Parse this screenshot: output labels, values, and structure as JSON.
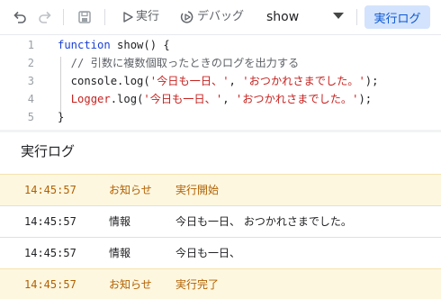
{
  "toolbar": {
    "undo_icon": "undo-icon",
    "redo_icon": "redo-icon",
    "save_icon": "save-icon",
    "run_label": "実行",
    "debug_label": "デバッグ",
    "function_select": "show",
    "log_button_label": "実行ログ"
  },
  "editor": {
    "lines": [
      {
        "number": "1",
        "tokens": [
          {
            "t": "function",
            "c": "kw"
          },
          {
            "t": " show() {",
            "c": "plain"
          }
        ]
      },
      {
        "number": "2",
        "tokens": [
          {
            "t": "  // 引数に複数個取ったときのログを出力する",
            "c": "cm"
          }
        ]
      },
      {
        "number": "3",
        "tokens": [
          {
            "t": "  console.log(",
            "c": "plain"
          },
          {
            "t": "'今日も一日、'",
            "c": "str"
          },
          {
            "t": ", ",
            "c": "plain"
          },
          {
            "t": "'おつかれさまでした。'",
            "c": "str"
          },
          {
            "t": ");",
            "c": "plain"
          }
        ]
      },
      {
        "number": "4",
        "tokens": [
          {
            "t": "  ",
            "c": "plain"
          },
          {
            "t": "Logger",
            "c": "obj"
          },
          {
            "t": ".log(",
            "c": "plain"
          },
          {
            "t": "'今日も一日、'",
            "c": "str"
          },
          {
            "t": ", ",
            "c": "plain"
          },
          {
            "t": "'おつかれさまでした。'",
            "c": "str"
          },
          {
            "t": ");",
            "c": "plain"
          }
        ]
      },
      {
        "number": "5",
        "tokens": [
          {
            "t": "}",
            "c": "plain"
          }
        ]
      }
    ]
  },
  "log_panel": {
    "title": "実行ログ",
    "rows": [
      {
        "time": "14:45:57",
        "type": "お知らせ",
        "message": "実行開始",
        "kind": "notice"
      },
      {
        "time": "14:45:57",
        "type": "情報",
        "message": "今日も一日、 おつかれさまでした。",
        "kind": "info"
      },
      {
        "time": "14:45:57",
        "type": "情報",
        "message": "今日も一日、",
        "kind": "info"
      },
      {
        "time": "14:45:57",
        "type": "お知らせ",
        "message": "実行完了",
        "kind": "notice"
      }
    ]
  },
  "colors": {
    "accent": "#0b57d0",
    "accent_bg": "#d3e3fd",
    "notice_bg": "#fef7e0",
    "notice_text": "#b06000",
    "keyword": "#1a3fd6",
    "string": "#c5221f"
  }
}
